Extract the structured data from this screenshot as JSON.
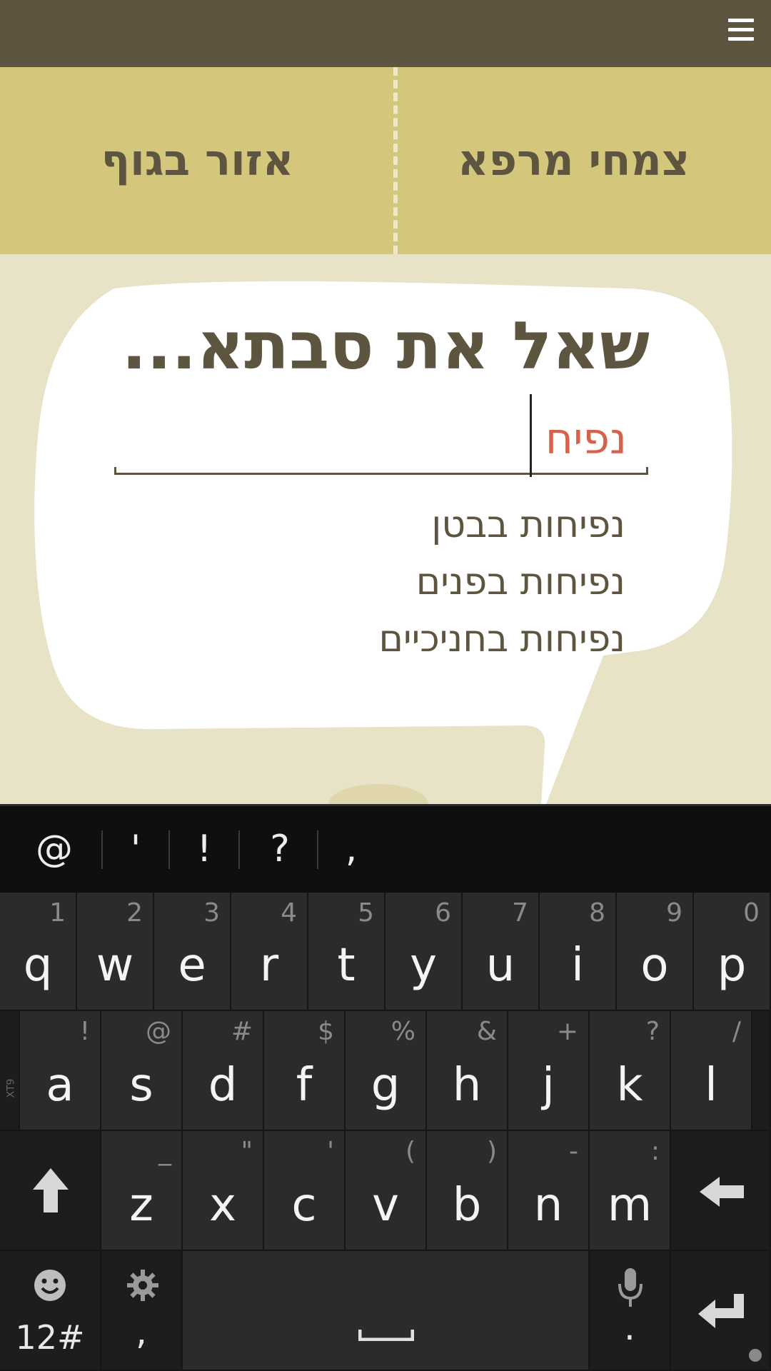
{
  "header": {
    "menu_icon": "hamburger-menu-icon"
  },
  "tabs": [
    {
      "label": "צמחי מרפא"
    },
    {
      "label": "אזור בגוף"
    }
  ],
  "bubble": {
    "title": "שאל את סבתא...",
    "search_value": "נפיח",
    "suggestions": [
      "נפיחות בבטן",
      "נפיחות בפנים",
      "נפיחות בחניכיים"
    ]
  },
  "keyboard": {
    "suggestion_bar": [
      "@",
      "'",
      "!",
      "?",
      ","
    ],
    "row1": [
      {
        "main": "q",
        "sec": "1"
      },
      {
        "main": "w",
        "sec": "2"
      },
      {
        "main": "e",
        "sec": "3"
      },
      {
        "main": "r",
        "sec": "4"
      },
      {
        "main": "t",
        "sec": "5"
      },
      {
        "main": "y",
        "sec": "6"
      },
      {
        "main": "u",
        "sec": "7"
      },
      {
        "main": "i",
        "sec": "8"
      },
      {
        "main": "o",
        "sec": "9"
      },
      {
        "main": "p",
        "sec": "0"
      }
    ],
    "row2": [
      {
        "main": "a",
        "sec": "!"
      },
      {
        "main": "s",
        "sec": "@"
      },
      {
        "main": "d",
        "sec": "#"
      },
      {
        "main": "f",
        "sec": "$"
      },
      {
        "main": "g",
        "sec": "%"
      },
      {
        "main": "h",
        "sec": "&"
      },
      {
        "main": "j",
        "sec": "+"
      },
      {
        "main": "k",
        "sec": "?"
      },
      {
        "main": "l",
        "sec": "/"
      }
    ],
    "row3": [
      {
        "main": "z",
        "sec": "_"
      },
      {
        "main": "x",
        "sec": "\""
      },
      {
        "main": "c",
        "sec": "'"
      },
      {
        "main": "v",
        "sec": "("
      },
      {
        "main": "b",
        "sec": ")"
      },
      {
        "main": "n",
        "sec": "-"
      },
      {
        "main": "m",
        "sec": ":"
      }
    ],
    "xt9_label": "XT9",
    "symbols_label": "12#",
    "comma_label": ",",
    "period_label": ".",
    "colors": {
      "accent": "#D8614B",
      "brand_dark": "#5E5540",
      "tab_bg": "#D4C67B",
      "page_bg": "#E8E3C6"
    }
  }
}
